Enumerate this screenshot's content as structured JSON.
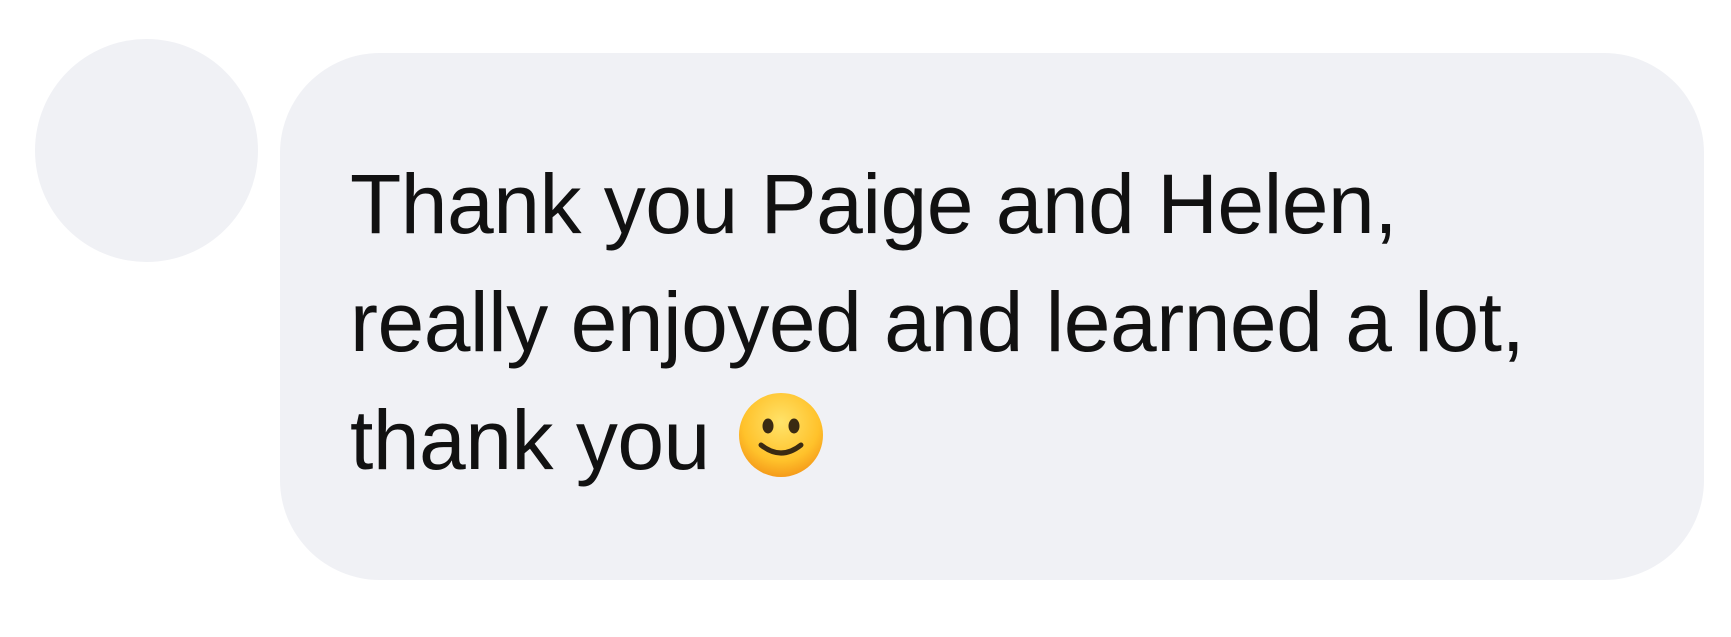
{
  "comment": {
    "avatar": "avatar-placeholder",
    "bubble_color": "#f0f1f5",
    "text_color": "#111111",
    "lines": [
      "Thank you Paige and Helen,",
      "really enjoyed and learned a lot,",
      "thank you"
    ],
    "emoji": "slightly-smiling-face-icon"
  }
}
